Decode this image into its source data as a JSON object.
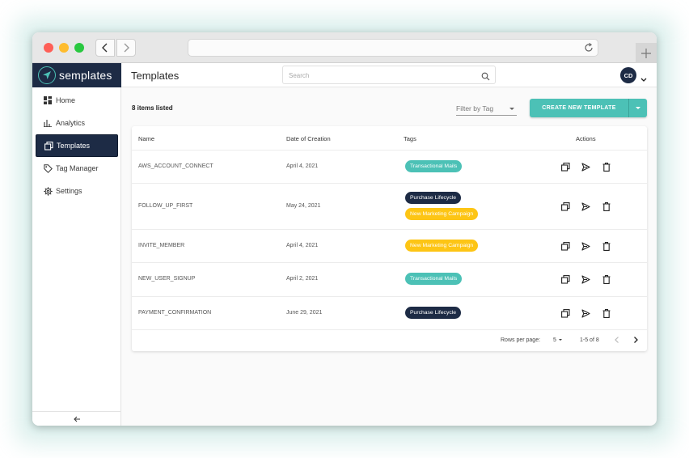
{
  "app": {
    "brand": "semplates",
    "accent": "#4cc1b6",
    "navy": "#1d2b45"
  },
  "sidebar": {
    "items": [
      {
        "label": "Home",
        "icon": "dashboard-icon",
        "active": false
      },
      {
        "label": "Analytics",
        "icon": "bar-chart-icon",
        "active": false
      },
      {
        "label": "Templates",
        "icon": "copy-icon",
        "active": true
      },
      {
        "label": "Tag Manager",
        "icon": "tag-icon",
        "active": false
      },
      {
        "label": "Settings",
        "icon": "gear-icon",
        "active": false
      }
    ],
    "collapse_icon": "arrow-left-icon"
  },
  "header": {
    "title": "Templates",
    "search_placeholder": "Search",
    "avatar_initials": "CD"
  },
  "toolbar": {
    "count_text": "8 items listed",
    "filter_label": "Filter by Tag",
    "create_label": "CREATE NEW TEMPLATE"
  },
  "table": {
    "columns": [
      "Name",
      "Date of Creation",
      "Tags",
      "Actions"
    ],
    "rows": [
      {
        "name": "AWS_ACCOUNT_CONNECT",
        "date": "April 4, 2021",
        "tags": [
          "Transactional Mails"
        ]
      },
      {
        "name": "FOLLOW_UP_FIRST",
        "date": "May 24, 2021",
        "tags": [
          "Purchase Lifecycle",
          "New Marketing Campaign"
        ]
      },
      {
        "name": "INVITE_MEMBER",
        "date": "April 4, 2021",
        "tags": [
          "New Marketing Campaign"
        ]
      },
      {
        "name": "NEW_USER_SIGNUP",
        "date": "April 2, 2021",
        "tags": [
          "Transactional Mails"
        ]
      },
      {
        "name": "PAYMENT_CONFIRMATION",
        "date": "June 29, 2021",
        "tags": [
          "Purchase Lifecycle"
        ]
      }
    ],
    "tag_colors": {
      "Transactional Mails": {
        "bg": "#4cc1b6",
        "fg": "#ffffff"
      },
      "Purchase Lifecycle": {
        "bg": "#1d2b45",
        "fg": "#ffffff"
      },
      "New Marketing Campaign": {
        "bg": "#fdc515",
        "fg": "#ffffff"
      }
    }
  },
  "pagination": {
    "rows_per_page_label": "Rows per page:",
    "rows_per_page_value": "5",
    "range_text": "1-5 of 8"
  }
}
